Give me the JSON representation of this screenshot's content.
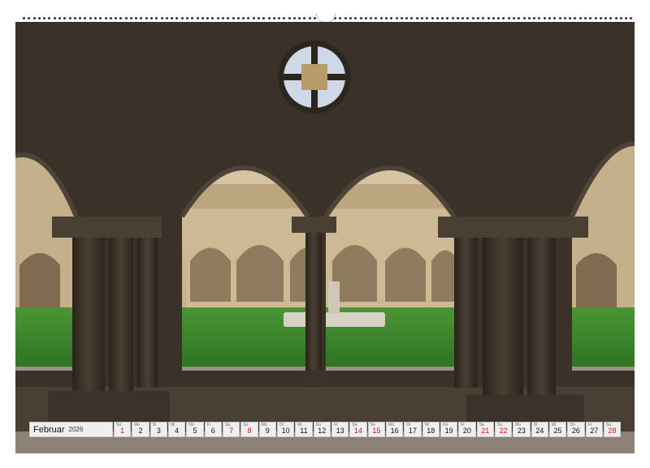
{
  "calendar": {
    "month": "Februar",
    "year": "2026",
    "days": [
      {
        "wd": "So",
        "num": "1",
        "red": true
      },
      {
        "wd": "Mo",
        "num": "2",
        "red": false
      },
      {
        "wd": "Di",
        "num": "3",
        "red": false
      },
      {
        "wd": "Mi",
        "num": "4",
        "red": false
      },
      {
        "wd": "Do",
        "num": "5",
        "red": false
      },
      {
        "wd": "Fr",
        "num": "6",
        "red": false
      },
      {
        "wd": "Sa",
        "num": "7",
        "red": true
      },
      {
        "wd": "So",
        "num": "8",
        "red": true
      },
      {
        "wd": "Mo",
        "num": "9",
        "red": false
      },
      {
        "wd": "Di",
        "num": "10",
        "red": false
      },
      {
        "wd": "Mi",
        "num": "11",
        "red": false
      },
      {
        "wd": "Do",
        "num": "12",
        "red": false
      },
      {
        "wd": "Fr",
        "num": "13",
        "red": false
      },
      {
        "wd": "Sa",
        "num": "14",
        "red": true
      },
      {
        "wd": "So",
        "num": "15",
        "red": true
      },
      {
        "wd": "Mo",
        "num": "16",
        "red": false
      },
      {
        "wd": "Di",
        "num": "17",
        "red": false
      },
      {
        "wd": "Mi",
        "num": "18",
        "red": false
      },
      {
        "wd": "Do",
        "num": "19",
        "red": false
      },
      {
        "wd": "Fr",
        "num": "20",
        "red": false
      },
      {
        "wd": "Sa",
        "num": "21",
        "red": true
      },
      {
        "wd": "So",
        "num": "22",
        "red": true
      },
      {
        "wd": "Mo",
        "num": "23",
        "red": false
      },
      {
        "wd": "Di",
        "num": "24",
        "red": false
      },
      {
        "wd": "Mi",
        "num": "25",
        "red": false
      },
      {
        "wd": "Do",
        "num": "26",
        "red": false
      },
      {
        "wd": "Fr",
        "num": "27",
        "red": false
      },
      {
        "wd": "Sa",
        "num": "28",
        "red": true
      }
    ]
  },
  "colors": {
    "stone_dark": "#3a3128",
    "stone_light": "#c9b58f",
    "lawn": "#3f8a2e",
    "sunday_red": "#c0181c"
  }
}
